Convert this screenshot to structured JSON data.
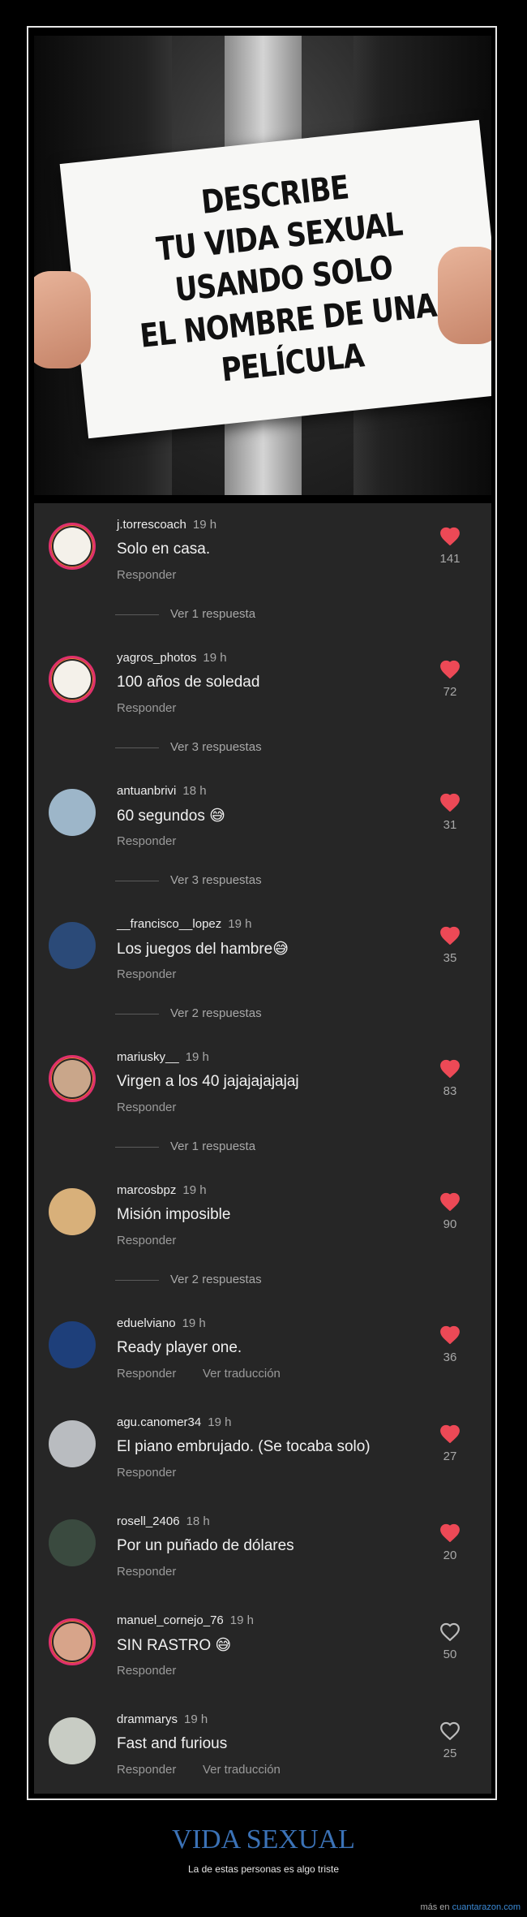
{
  "sign": {
    "text": "DESCRIBE\nTU VIDA SEXUAL\nUSANDO SOLO\nEL NOMBRE DE UNA\nPELÍCULA"
  },
  "comments": [
    {
      "user": "j.torrescoach",
      "time": "19 h",
      "text": "Solo en casa.",
      "reply": "Responder",
      "likes": "141",
      "liked": true,
      "more": "Ver 1 respuesta",
      "avatar_color": "#f4f1ea"
    },
    {
      "user": "yagros_photos",
      "time": "19 h",
      "text": "100 años de soledad",
      "reply": "Responder",
      "likes": "72",
      "liked": true,
      "more": "Ver 3 respuestas",
      "avatar_color": "#f4f1ea"
    },
    {
      "user": "antuanbrivi",
      "time": "18 h",
      "text": "60 segundos 😅",
      "reply": "Responder",
      "likes": "31",
      "liked": true,
      "more": "Ver 3 respuestas",
      "avatar_color": "#9db6c9"
    },
    {
      "user": "__francisco__lopez",
      "time": "19 h",
      "text": "Los juegos del hambre😅",
      "reply": "Responder",
      "likes": "35",
      "liked": true,
      "more": "Ver 2 respuestas",
      "avatar_color": "#2b4a78"
    },
    {
      "user": "mariusky__",
      "time": "19 h",
      "text": "Virgen a los 40 jajajajajajaj",
      "reply": "Responder",
      "likes": "83",
      "liked": true,
      "more": "Ver 1 respuesta",
      "avatar_color": "#c9a68a"
    },
    {
      "user": "marcosbpz",
      "time": "19 h",
      "text": "Misión imposible",
      "reply": "Responder",
      "likes": "90",
      "liked": true,
      "more": "Ver 2 respuestas",
      "avatar_color": "#d8b07a"
    },
    {
      "user": "eduelviano",
      "time": "19 h",
      "text": "Ready player one.",
      "reply": "Responder",
      "translate": "Ver traducción",
      "likes": "36",
      "liked": true,
      "avatar_color": "#1e3f7a"
    },
    {
      "user": "agu.canomer34",
      "time": "19 h",
      "text": "El piano embrujado. (Se tocaba solo)",
      "reply": "Responder",
      "likes": "27",
      "liked": true,
      "avatar_color": "#b9bcc0"
    },
    {
      "user": "rosell_2406",
      "time": "18 h",
      "text": "Por un puñado de dólares",
      "reply": "Responder",
      "likes": "20",
      "liked": true,
      "avatar_color": "#3a4a3f"
    },
    {
      "user": "manuel_cornejo_76",
      "time": "19 h",
      "text": "SIN RASTRO 😅",
      "reply": "Responder",
      "likes": "50",
      "liked": false,
      "avatar_color": "#d7a48a"
    },
    {
      "user": "drammarys",
      "time": "19 h",
      "text": "Fast and furious",
      "reply": "Responder",
      "translate": "Ver traducción",
      "likes": "25",
      "liked": false,
      "avatar_color": "#c8ccc4"
    }
  ],
  "footer": {
    "title": "VIDA SEXUAL",
    "subtitle": "La de estas personas es algo triste",
    "more_prefix": "más en",
    "more_link": "cuantarazon.com"
  },
  "colors": {
    "heart": "#ed4956",
    "accent": "#3b72b6"
  }
}
